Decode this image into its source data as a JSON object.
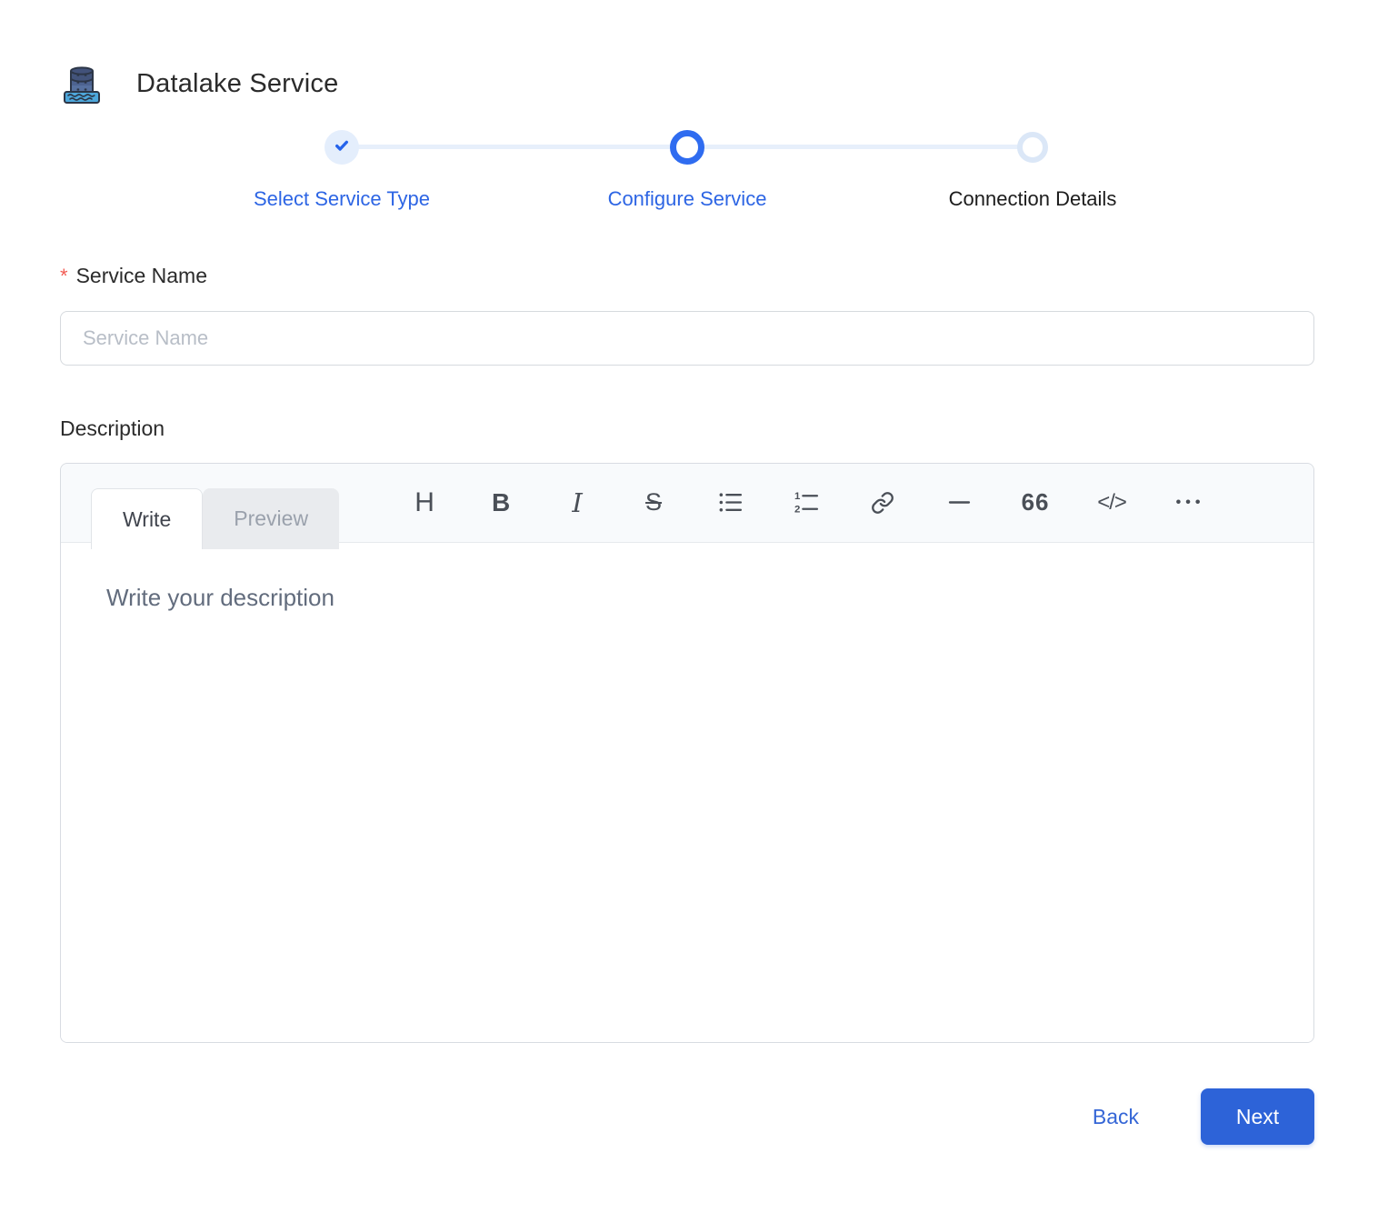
{
  "header": {
    "title": "Datalake Service",
    "icon": "datalake-service-icon"
  },
  "stepper": {
    "steps": [
      {
        "label": "Select Service Type",
        "state": "completed"
      },
      {
        "label": "Configure Service",
        "state": "active"
      },
      {
        "label": "Connection Details",
        "state": "pending"
      }
    ]
  },
  "form": {
    "service_name": {
      "required_marker": "*",
      "label": "Service Name",
      "placeholder": "Service Name",
      "value": ""
    },
    "description": {
      "label": "Description",
      "editor": {
        "tabs": {
          "write": "Write",
          "preview": "Preview"
        },
        "active_tab": "Write",
        "toolbar": {
          "heading": "H",
          "bold": "B",
          "italic": "I",
          "strikethrough": "S",
          "bulleted_list": "bulleted-list-icon",
          "numbered_list": "numbered-list-icon",
          "link": "link-icon",
          "horizontal_rule": "horizontal-rule-icon",
          "quote": "66",
          "code": "</>",
          "more": "•••"
        },
        "placeholder": "Write your description",
        "value": ""
      }
    }
  },
  "footer": {
    "back_label": "Back",
    "next_label": "Next"
  },
  "colors": {
    "primary_blue": "#2D63D8",
    "stepper_blue": "#2F6CF0",
    "stepper_light": "#E7EFFB",
    "completed_bg": "#E4EEFC",
    "required_red": "#F25C54"
  }
}
